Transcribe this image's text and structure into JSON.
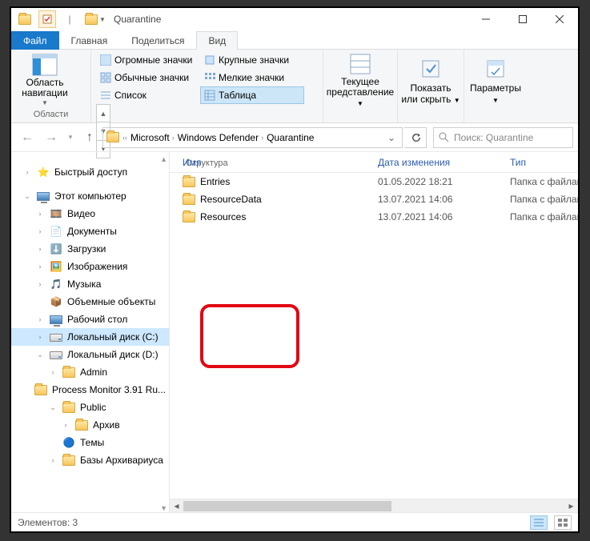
{
  "window": {
    "title": "Quarantine"
  },
  "tabs": {
    "file": "Файл",
    "home": "Главная",
    "share": "Поделиться",
    "view": "Вид"
  },
  "ribbon": {
    "panes": {
      "navpane": "Область навигации",
      "panes_label": "Области"
    },
    "layout": {
      "huge": "Огромные значки",
      "large": "Крупные значки",
      "medium": "Обычные значки",
      "small": "Мелкие значки",
      "list": "Список",
      "table": "Таблица",
      "label": "Структура"
    },
    "current": {
      "line1": "Текущее",
      "line2": "представление"
    },
    "show": {
      "line1": "Показать",
      "line2": "или скрыть"
    },
    "options": "Параметры"
  },
  "breadcrumb": [
    "Microsoft",
    "Windows Defender",
    "Quarantine"
  ],
  "search": {
    "placeholder": "Поиск: Quarantine"
  },
  "columns": {
    "name": "Имя",
    "date": "Дата изменения",
    "type": "Тип"
  },
  "rows": [
    {
      "name": "Entries",
      "date": "01.05.2022 18:21",
      "type": "Папка с файлами"
    },
    {
      "name": "ResourceData",
      "date": "13.07.2021 14:06",
      "type": "Папка с файлами"
    },
    {
      "name": "Resources",
      "date": "13.07.2021 14:06",
      "type": "Папка с файлами"
    }
  ],
  "nav": {
    "quick": "Быстрый доступ",
    "thispc": "Этот компьютер",
    "video": "Видео",
    "documents": "Документы",
    "downloads": "Загрузки",
    "pictures": "Изображения",
    "music": "Музыка",
    "objects3d": "Объемные объекты",
    "desktop": "Рабочий стол",
    "cdrive": "Локальный диск (C:)",
    "ddrive": "Локальный диск (D:)",
    "admin": "Admin",
    "procmon": "Process Monitor 3.91 Ru...",
    "public": "Public",
    "archive": "Архив",
    "themes": "Темы",
    "bases": "Базы Архивариуса"
  },
  "status": {
    "items": "Элементов: 3"
  }
}
